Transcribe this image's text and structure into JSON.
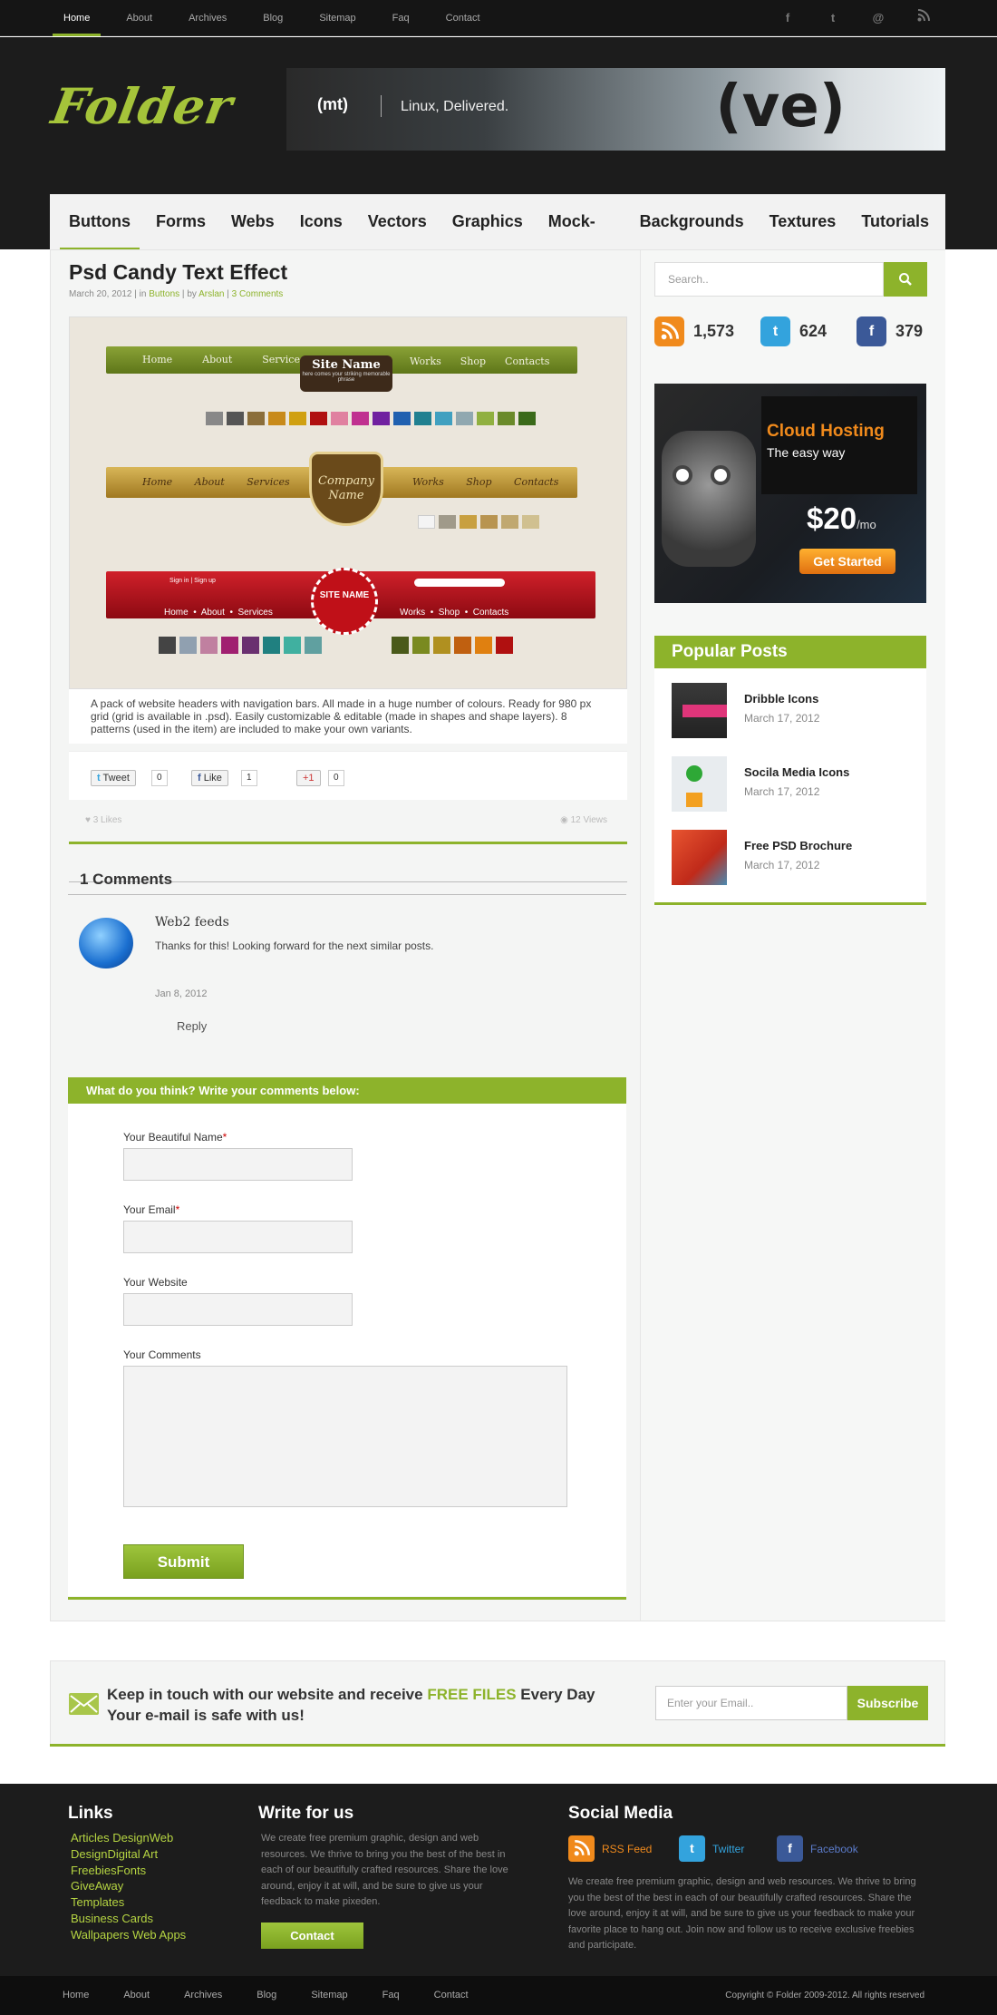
{
  "topnav": [
    "Home",
    "About",
    "Archives",
    "Blog",
    "Sitemap",
    "Faq",
    "Contact"
  ],
  "topicons": [
    "f",
    "t",
    "@",
    "rss"
  ],
  "logo": "Folder",
  "banner": {
    "brand": "(mt)",
    "tagline": "Linux, Delivered.",
    "mark": "(ve)"
  },
  "catnav": [
    "Buttons",
    "Forms",
    "Webs",
    "Icons",
    "Vectors",
    "Graphics",
    "Mock-Ups",
    "Backgrounds",
    "Textures",
    "Tutorials"
  ],
  "post": {
    "title": "Psd Candy Text Effect",
    "date": "March 20, 2012",
    "in": "in",
    "category": "Buttons",
    "by": "by",
    "author": "Arslan",
    "comments_link": "3 Comments",
    "image_texts": {
      "nav1": [
        "Home",
        "About",
        "Services",
        "Works",
        "Shop",
        "Contacts"
      ],
      "site_name": "Site Name",
      "site_sub": "here comes your striking memorable phrase",
      "company": "Company Name",
      "nav2": [
        "Home",
        "About",
        "Services",
        "Works",
        "Shop",
        "Contacts"
      ],
      "site_name3": "SITE NAME",
      "nav3": [
        "Home",
        "About",
        "Services",
        "Works",
        "Shop",
        "Contacts"
      ],
      "signin": "Sign in  |  Sign up"
    },
    "description": "A pack of website headers with navigation bars. All made in a huge number of colours. Ready for 980 px grid (grid is available in .psd). Easily customizable & editable (made in shapes and shape layers). 8 patterns (used in the item) are included to make your own variants.",
    "share": {
      "tweet": "Tweet",
      "tweet_count": "0",
      "like": "Like",
      "like_count": "1",
      "plus": "+1",
      "plus_count": "0"
    },
    "likes": "3 Likes",
    "views": "12 Views"
  },
  "comments": {
    "heading": "1 Comments",
    "items": [
      {
        "name": "Web2 feeds",
        "text": "Thanks for this! Looking forward for the next similar posts.",
        "date": "Jan 8, 2012",
        "reply": "Reply"
      }
    ]
  },
  "form": {
    "heading": "What do you think? Write your comments below:",
    "name_label": "Your Beautiful Name",
    "email_label": "Your Email",
    "website_label": "Your Website",
    "comments_label": "Your Comments",
    "required_mark": "*",
    "submit": "Submit"
  },
  "sidebar": {
    "search_placeholder": "Search..",
    "rss_count": "1,573",
    "twitter_count": "624",
    "facebook_count": "379",
    "ad": {
      "title": "Cloud Hosting",
      "subtitle": "The easy way",
      "price": "$20",
      "per": "/mo",
      "cta": "Get Started"
    },
    "popular_heading": "Popular Posts",
    "popular": [
      {
        "title": "Dribble Icons",
        "date": "March 17, 2012"
      },
      {
        "title": "Socila Media Icons",
        "date": "March 17, 2012"
      },
      {
        "title": "Free PSD Brochure",
        "date": "March 17, 2012"
      }
    ]
  },
  "newsletter": {
    "line1_a": "Keep in touch with our website and receive ",
    "line1_b": "FREE FILES",
    "line1_c": " Every Day",
    "line2": "Your e-mail is safe with us!",
    "placeholder": "Enter your Email..",
    "button": "Subscribe"
  },
  "footer": {
    "links_heading": "Links",
    "links": [
      "Articles DesignWeb",
      "DesignDigital Art",
      "FreebiesFonts",
      "GiveAway",
      "Templates",
      "Business Cards",
      "Wallpapers Web Apps"
    ],
    "write_heading": "Write for us",
    "write_text": "We create free premium graphic, design and web resources. We thrive to bring you the best of the best in each of our beautifully crafted resources. Share the love around, enjoy it at will, and be sure to give us your feedback to make pixeden.",
    "contact_button": "Contact",
    "social_heading": "Social Media",
    "rss_label": "RSS Feed",
    "twitter_label": "Twitter",
    "facebook_label": "Facebook",
    "social_text": "We create free premium graphic, design and web resources. We thrive to bring you the best of the best in each of our beautifully crafted resources. Share the love around, enjoy it at will, and be sure to give us your feedback to make your favorite place to hang out. Join now and follow us to receive exclusive freebies and participate."
  },
  "bottomnav": [
    "Home",
    "About",
    "Archives",
    "Blog",
    "Sitemap",
    "Faq",
    "Contact"
  ],
  "copyright": "Copyright © Folder 2009-2012. All rights reserved",
  "colors": {
    "accent": "#8db32b",
    "dark": "#1c1c1c",
    "rss": "#f08a1c",
    "twitter": "#33a3dd",
    "facebook": "#3b5998"
  }
}
